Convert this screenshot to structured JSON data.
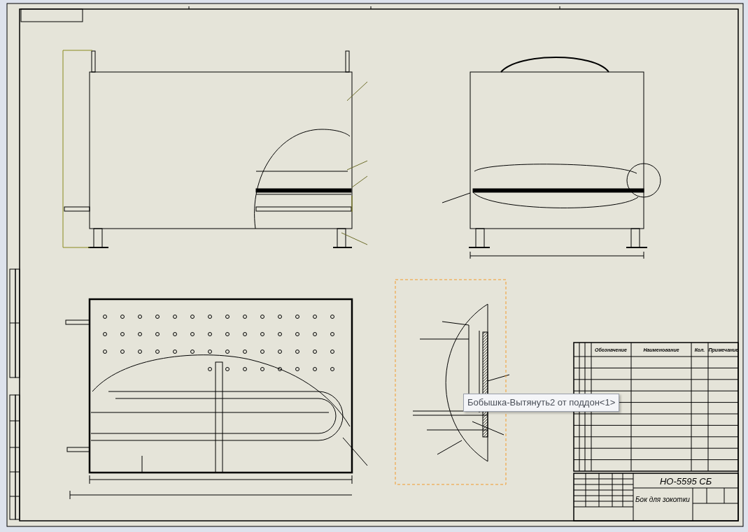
{
  "detail_view": {
    "selected": true
  },
  "tooltip": {
    "text": "Бобышка-Вытянуть2 от поддон<1>"
  },
  "spec_table": {
    "columns": [
      "Обозначение",
      "Наименование",
      "Кол.",
      "Примечание"
    ]
  },
  "title_block": {
    "designation": "НО-5595 СБ",
    "name": "Бок для зокотки"
  }
}
